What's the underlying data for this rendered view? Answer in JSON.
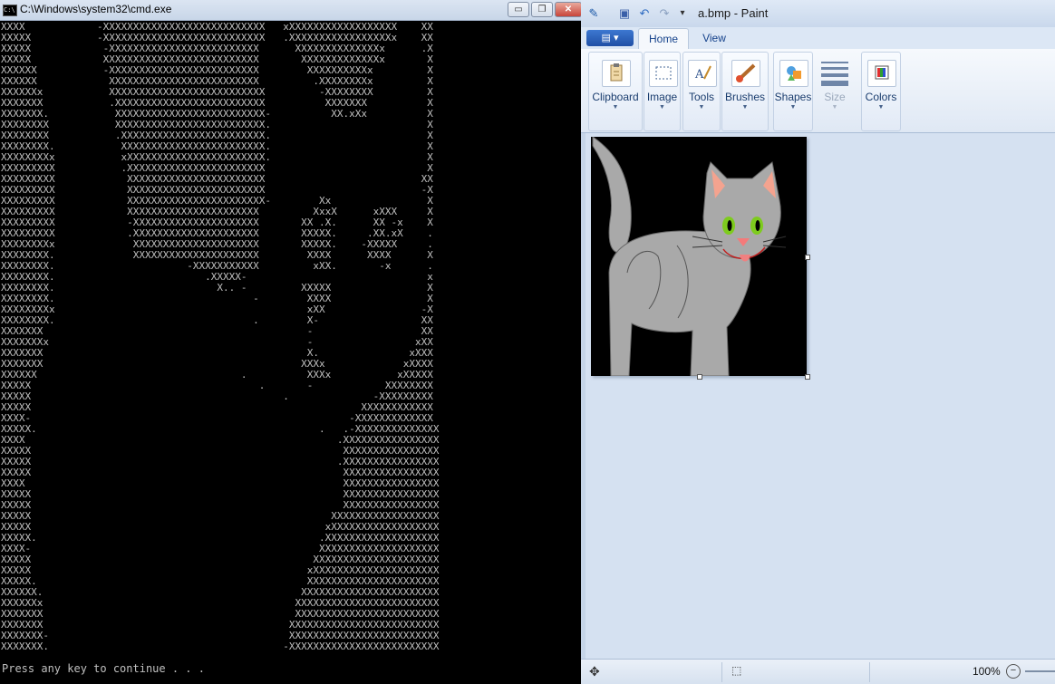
{
  "cmd": {
    "title": "C:\\Windows\\system32\\cmd.exe",
    "icon": "C:\\",
    "buttons": {
      "minimize": "▭",
      "maximize": "❐",
      "close": "✕"
    },
    "prompt": "Press any key to continue . . ."
  },
  "paint": {
    "title": "a.bmp - Paint",
    "quick_access": {
      "app": "✎",
      "save": "▣",
      "undo": "↶",
      "redo": "↷",
      "customize": "▾"
    },
    "app_menu": "▤ ▾",
    "tabs": {
      "home": "Home",
      "view": "View"
    },
    "groups": {
      "clipboard": "Clipboard",
      "image": "Image",
      "tools": "Tools",
      "brushes": "Brushes",
      "shapes": "Shapes",
      "size": "Size",
      "colors": "Colors"
    },
    "dropdown_glyph": "▼",
    "status": {
      "move_icon": "✥",
      "selection_icon": "⬚",
      "zoom": "100%",
      "zoom_out": "−"
    },
    "colors": {
      "accent": "#1f4fa5",
      "canvas_bg": "#000000",
      "cat_body": "#a9a9a9",
      "cat_ear_inner": "#f4a38f",
      "cat_eye": "#7ecb1e",
      "cat_nose": "#f47a7a"
    }
  }
}
